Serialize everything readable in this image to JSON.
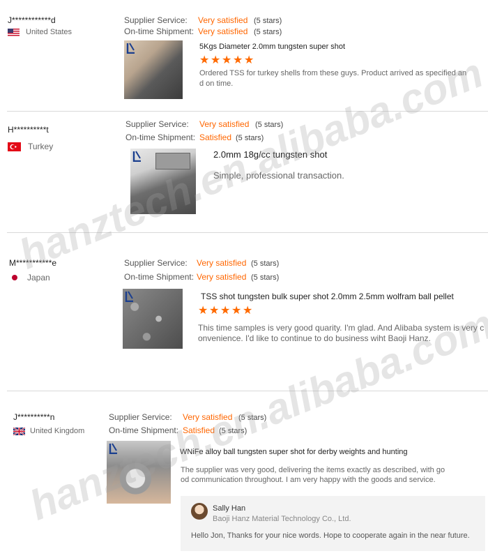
{
  "reviews": [
    {
      "buyer": "J************d",
      "country": "United States",
      "supplier_service_label": "Supplier Service:",
      "supplier_service_value": "Very satisfied",
      "supplier_service_stars": "(5 stars)",
      "shipment_label": "On-time Shipment:",
      "shipment_value": "Very satisfied",
      "shipment_stars": "(5 stars)",
      "product_title": "5Kgs Diameter 2.0mm tungsten super shot",
      "rating": 5,
      "comment_line1": "Ordered TSS for turkey shells from these guys. Product arrived as specified an",
      "comment_line2": "d on time."
    },
    {
      "buyer": "H**********t",
      "country": "Turkey",
      "supplier_service_label": "Supplier Service:",
      "supplier_service_value": "Very satisfied",
      "supplier_service_stars": "(5 stars)",
      "shipment_label": "On-time Shipment:",
      "shipment_value": "Satisfied",
      "shipment_stars": "(5 stars)",
      "product_title": "2.0mm 18g/cc tungsten shot",
      "comment_line1": "Simple, professional transaction."
    },
    {
      "buyer": "M***********e",
      "country": "Japan",
      "supplier_service_label": "Supplier Service:",
      "supplier_service_value": "Very satisfied",
      "supplier_service_stars": "(5 stars)",
      "shipment_label": "On-time Shipment:",
      "shipment_value": "Very satisfied",
      "shipment_stars": "(5 stars)",
      "product_title": "TSS shot tungsten bulk super shot 2.0mm 2.5mm wolfram ball pellet",
      "rating": 5,
      "comment_line1": "This time samples is very good quarity. I'm glad. And Alibaba system is very c",
      "comment_line2": "onvenience. I'd like to continue to do business wiht Baoji Hanz."
    },
    {
      "buyer": "J**********n",
      "country": "United Kingdom",
      "supplier_service_label": "Supplier Service:",
      "supplier_service_value": "Very satisfied",
      "supplier_service_stars": "(5 stars)",
      "shipment_label": "On-time Shipment:",
      "shipment_value": "Satisfied",
      "shipment_stars": "(5 stars)",
      "product_title": "WNiFe alloy ball tungsten super shot for derby weights and hunting",
      "comment_line1": "The supplier was very good, delivering the items exactly as described, with go",
      "comment_line2": "od communication throughout. I am very happy with the goods and service.",
      "reply": {
        "name": "Sally Han",
        "company": "Baoji Hanz Material Technology Co., Ltd.",
        "text": "Hello Jon, Thanks for your nice words. Hope to cooperate again in the near future."
      }
    }
  ],
  "watermarks": [
    "hanztech.en.alibaba.com",
    "hanztech.en.alibaba.com"
  ],
  "colors": {
    "accent": "#ff6600",
    "star": "#ff6a00",
    "separator": "#d9d9d9"
  }
}
